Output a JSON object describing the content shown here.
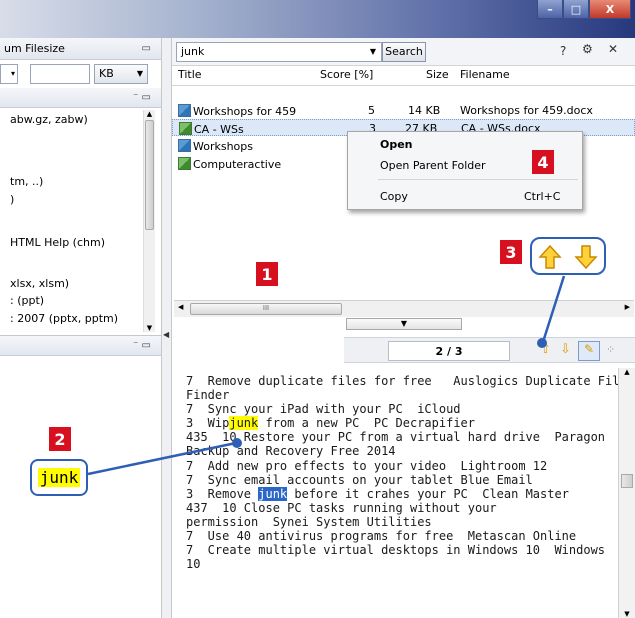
{
  "window": {
    "minimize_glyph": "–",
    "maximize_glyph": "□",
    "close_glyph": "X"
  },
  "left_panel": {
    "header1": "um Filesize",
    "size_unit": "KB",
    "items": [
      "abw.gz, zabw)",
      "tm, ..)",
      ")",
      "HTML Help (chm)",
      "xlsx, xlsm)",
      ": (ppt)",
      ": 2007 (pptx, pptm)"
    ]
  },
  "search": {
    "query": "junk",
    "button_label": "Search"
  },
  "results": {
    "columns": [
      "Title",
      "Score [%]",
      "Size",
      "Filename"
    ],
    "rows": [
      {
        "title": "Workshops for 459",
        "score": "5",
        "size": "14 KB",
        "filename": "Workshops for 459.docx",
        "icon": "word-doc-icon"
      },
      {
        "title": "CA - WSs",
        "score": "3",
        "size": "27 KB",
        "filename": "CA - WSs.docx",
        "icon": "excel-doc-icon"
      },
      {
        "title": "Workshops",
        "score": "",
        "size": "",
        "filename": "",
        "icon": "word-doc-icon"
      },
      {
        "title": "Computeractive",
        "score": "",
        "size": "",
        "filename": "",
        "icon": "excel-doc-icon"
      }
    ]
  },
  "context_menu": {
    "open": "Open",
    "open_parent": "Open Parent Folder",
    "copy": "Copy",
    "copy_shortcut": "Ctrl+C"
  },
  "annotations": {
    "b1": "1",
    "b2": "2",
    "b3": "3",
    "b4": "4",
    "junk_label": "junk",
    "color": "#d6101f"
  },
  "nav": {
    "counter": "2 / 3",
    "hscroll_thumb": "III"
  },
  "preview_lines": [
    [
      "7  Remove duplicate files for free   Auslogics Duplicate File"
    ],
    [
      "Finder"
    ],
    [
      "7  Sync your iPad with your PC  iCloud"
    ],
    [
      "3  Wip",
      "junk",
      " from a new PC  PC Decrapifier",
      "hl"
    ],
    [
      "435  10 Restore your PC from a virtual hard drive  Paragon"
    ],
    [
      "Backup and Recovery Free 2014"
    ],
    [
      "7  Add new pro effects to your video  Lightroom 12"
    ],
    [
      "7  Sync email accounts on your tablet Blue Email"
    ],
    [
      "3  Remove ",
      "junk",
      " before it crahes your PC  Clean Master",
      "hlsel"
    ],
    [
      "437  10 Close PC tasks running without your"
    ],
    [
      "permission  Synei System Utilities"
    ],
    [
      "7  Use 40 antivirus programs for free  Metascan Online"
    ],
    [
      "7  Create multiple virtual desktops in Windows 10  Windows"
    ],
    [
      "10"
    ]
  ]
}
